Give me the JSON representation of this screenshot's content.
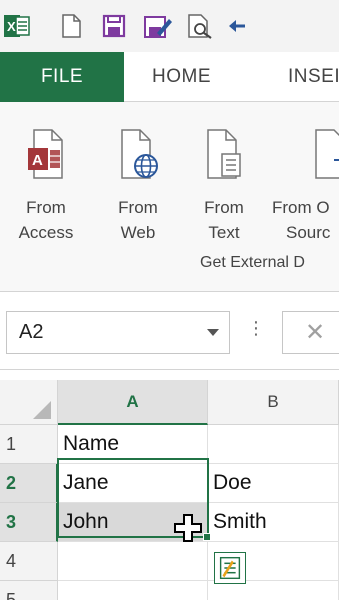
{
  "qat": {
    "icons": [
      "excel-logo-icon",
      "new-document-icon",
      "save-icon",
      "edit-icon",
      "print-preview-icon",
      "undo-icon"
    ],
    "excel_logo_letter": "X"
  },
  "tabs": {
    "file": "FILE",
    "home": "HOME",
    "insert": "INSEI"
  },
  "ribbon": {
    "buttons": [
      {
        "line1": "From",
        "line2": "Access"
      },
      {
        "line1": "From",
        "line2": "Web"
      },
      {
        "line1": "From",
        "line2": "Text"
      },
      {
        "line1": "From O",
        "line2": "Sourc"
      }
    ],
    "group_label": "Get External D"
  },
  "formula_bar": {
    "name_box": "A2",
    "separator": "⋮",
    "cancel": "✕"
  },
  "grid": {
    "columns": [
      "A",
      "B"
    ],
    "rows": [
      {
        "num": "1",
        "a": "Name",
        "b": ""
      },
      {
        "num": "2",
        "a": "Jane",
        "b": "Doe"
      },
      {
        "num": "3",
        "a": "John",
        "b": "Smith"
      },
      {
        "num": "4",
        "a": "",
        "b": ""
      },
      {
        "num": "5",
        "a": "",
        "b": ""
      }
    ]
  },
  "colors": {
    "accent": "#217346",
    "access_red": "#a4373a",
    "web_blue": "#2b579a",
    "selection_gray": "#d9d9d9"
  }
}
